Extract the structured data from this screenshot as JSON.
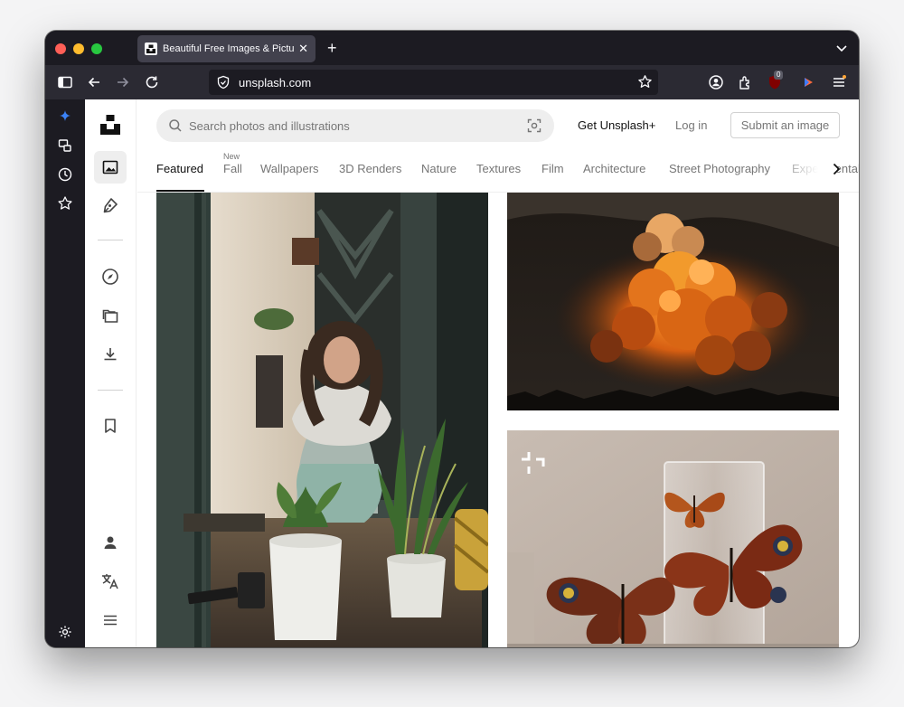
{
  "browser": {
    "tab": {
      "title": "Beautiful Free Images & Pictures | Unsplash"
    },
    "url": "unsplash.com",
    "extension_badge": "0"
  },
  "search": {
    "placeholder": "Search photos and illustrations",
    "value": ""
  },
  "header": {
    "get_plus": "Get Unsplash+",
    "login": "Log in",
    "submit": "Submit an image"
  },
  "topics": {
    "items": [
      {
        "label": "Featured",
        "active": true
      },
      {
        "label": "Fall",
        "new_label": "New"
      },
      {
        "label": "Wallpapers"
      },
      {
        "label": "3D Renders"
      },
      {
        "label": "Nature"
      },
      {
        "label": "Textures"
      },
      {
        "label": "Film"
      },
      {
        "label": "Architecture"
      },
      {
        "label": "Street Photography"
      },
      {
        "label": "Experimental"
      }
    ]
  },
  "icons": {
    "unsplash_sidebar": [
      "unsplash-logo",
      "image-icon",
      "pen-icon",
      "compass-icon",
      "collections-icon",
      "download-icon",
      "bookmark-icon",
      "user-icon",
      "translate-icon",
      "menu-icon"
    ],
    "browser_sidebar": [
      "sparkle-icon",
      "synced-tabs-icon",
      "history-icon",
      "bookmarks-star-icon",
      "settings-icon"
    ]
  },
  "photos": [
    {
      "subject": "woman-repotting-plants"
    },
    {
      "subject": "orange-storm-clouds"
    },
    {
      "subject": "butterflies-glass-vase",
      "plus": true
    }
  ]
}
